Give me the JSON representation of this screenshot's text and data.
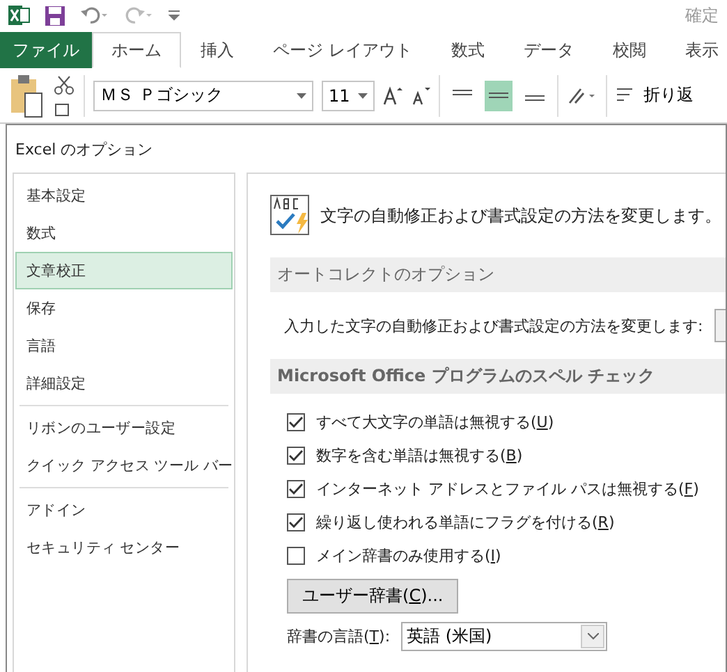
{
  "title_bar": {
    "title": "確定"
  },
  "ribbon_tabs": [
    {
      "label": "ファイル",
      "kind": "file",
      "selected": false
    },
    {
      "label": "ホーム",
      "kind": "tab",
      "selected": true
    },
    {
      "label": "挿入",
      "kind": "tab",
      "selected": false
    },
    {
      "label": "ページ レイアウト",
      "kind": "tab",
      "selected": false
    },
    {
      "label": "数式",
      "kind": "tab",
      "selected": false
    },
    {
      "label": "データ",
      "kind": "tab",
      "selected": false
    },
    {
      "label": "校閲",
      "kind": "tab",
      "selected": false
    },
    {
      "label": "表示",
      "kind": "tab",
      "selected": false
    }
  ],
  "ribbon": {
    "font_name": "ＭＳ Ｐゴシック",
    "font_size": "11",
    "wrap_text": "折り返",
    "align_buttons": [
      {
        "selected": false
      },
      {
        "selected": true
      },
      {
        "selected": false
      }
    ]
  },
  "dialog": {
    "title": "Excel のオプション",
    "sidebar_groups": [
      {
        "items": [
          {
            "label": "基本設定",
            "selected": false
          },
          {
            "label": "数式",
            "selected": false
          },
          {
            "label": "文章校正",
            "selected": true
          },
          {
            "label": "保存",
            "selected": false
          },
          {
            "label": "言語",
            "selected": false
          },
          {
            "label": "詳細設定",
            "selected": false
          }
        ]
      },
      {
        "items": [
          {
            "label": "リボンのユーザー設定",
            "selected": false
          },
          {
            "label": "クイック アクセス ツール バー",
            "selected": false
          }
        ]
      },
      {
        "items": [
          {
            "label": "アドイン",
            "selected": false
          },
          {
            "label": "セキュリティ センター",
            "selected": false
          }
        ]
      }
    ],
    "intro": "文字の自動修正および書式設定の方法を変更します。",
    "autocorrect_section": {
      "heading": "オートコレクトのオプション",
      "description": "入力した文字の自動修正および書式設定の方法を変更します:"
    },
    "spelling_section": {
      "heading": "Microsoft Office プログラムのスペル チェック",
      "options": [
        {
          "before": "すべて大文字の単語は無視する(",
          "key": "U",
          "after": ")",
          "checked": true
        },
        {
          "before": "数字を含む単語は無視する(",
          "key": "B",
          "after": ")",
          "checked": true
        },
        {
          "before": "インターネット アドレスとファイル パスは無視する(",
          "key": "F",
          "after": ")",
          "checked": true
        },
        {
          "before": "繰り返し使われる単語にフラグを付ける(",
          "key": "R",
          "after": ")",
          "checked": true
        },
        {
          "before": "メイン辞書のみ使用する(",
          "key": "I",
          "after": ")",
          "checked": false
        }
      ],
      "dictionary_button": {
        "before": "ユーザー辞書(",
        "key": "C",
        "after": ")..."
      },
      "language": {
        "before": "辞書の言語(",
        "key": "T",
        "after": "):",
        "value": "英語 (米国)"
      }
    }
  }
}
